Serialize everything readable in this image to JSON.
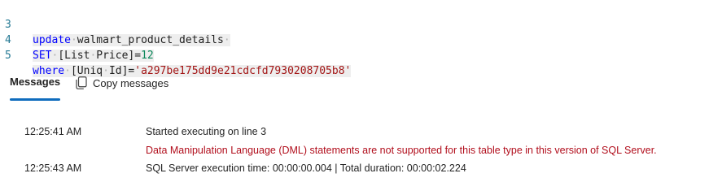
{
  "editor": {
    "lines": [
      {
        "number": "3",
        "tokens": [
          {
            "type": "kw",
            "text": "update"
          },
          {
            "type": "dot",
            "text": "·"
          },
          {
            "type": "ident",
            "text": "walmart_product_details"
          },
          {
            "type": "dot",
            "text": "·"
          }
        ]
      },
      {
        "number": "4",
        "tokens": [
          {
            "type": "kw",
            "text": "SET"
          },
          {
            "type": "dot",
            "text": "·"
          },
          {
            "type": "ident",
            "text": "[List"
          },
          {
            "type": "dot",
            "text": "·"
          },
          {
            "type": "ident",
            "text": "Price]"
          },
          {
            "type": "op",
            "text": "="
          },
          {
            "type": "num",
            "text": "12"
          }
        ]
      },
      {
        "number": "5",
        "tokens": [
          {
            "type": "kw",
            "text": "where"
          },
          {
            "type": "dot",
            "text": "·"
          },
          {
            "type": "ident",
            "text": "[Uniq"
          },
          {
            "type": "dot",
            "text": "·"
          },
          {
            "type": "ident",
            "text": "Id]"
          },
          {
            "type": "op",
            "text": "="
          },
          {
            "type": "str",
            "text": "'a297be175dd9e21cdcfd7930208705b8'"
          }
        ]
      }
    ]
  },
  "results": {
    "tab_messages": "Messages",
    "copy_messages": "Copy messages",
    "copy_icon": "copy-icon",
    "accent": "#0f6cbd",
    "error_color": "#b10e1c"
  },
  "messages": [
    {
      "time": "12:25:41 AM",
      "text": "Started executing on line 3",
      "kind": "info"
    },
    {
      "time": "",
      "text": "Data Manipulation Language (DML) statements are not supported for this table type in this version of SQL Server.",
      "kind": "error"
    },
    {
      "time": "12:25:43 AM",
      "text": "SQL Server execution time: 00:00:00.004 | Total duration: 00:00:02.224",
      "kind": "info"
    }
  ]
}
